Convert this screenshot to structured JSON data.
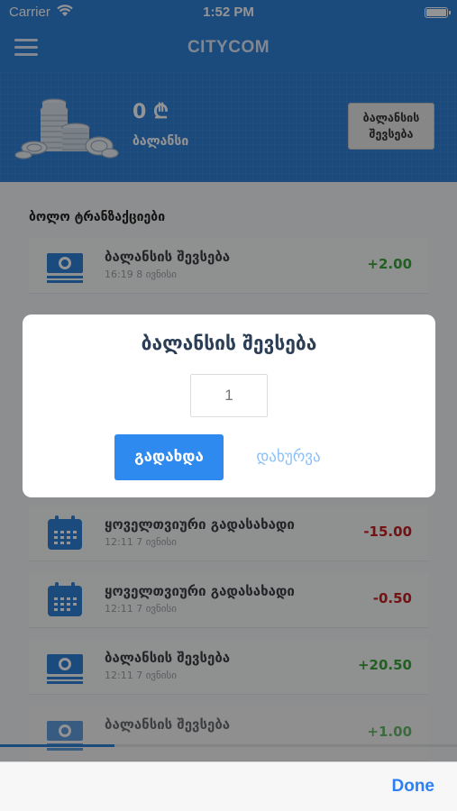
{
  "status_bar": {
    "carrier": "Carrier",
    "time": "1:52 PM"
  },
  "nav": {
    "title": "CITYCOM",
    "menu_icon": "hamburger-menu-icon"
  },
  "balance": {
    "value": "0 ₾",
    "label": "ბალანსი",
    "topup_button": "ბალანსის შევსება",
    "icon": "coins-stack-icon"
  },
  "transactions": {
    "title": "ბოლო ტრანზაქციები",
    "items": [
      {
        "name": "ბალანსის შევსება",
        "date": "16:19 8 ივნისი",
        "amount": "+2.00",
        "type": "topup",
        "icon": "money-icon"
      },
      {
        "name": "ყოველთვიური გადასახადი",
        "date": "12:11 7 ივნისი",
        "amount": "-15.00",
        "type": "fee",
        "icon": "calendar-icon"
      },
      {
        "name": "ყოველთვიური გადასახადი",
        "date": "12:11 7 ივნისი",
        "amount": "-0.50",
        "type": "fee",
        "icon": "calendar-icon"
      },
      {
        "name": "ბალანსის შევსება",
        "date": "12:11 7 ივნისი",
        "amount": "+20.50",
        "type": "topup",
        "icon": "money-icon"
      },
      {
        "name": "ბალანსის შევსება",
        "date": "",
        "amount": "+1.00",
        "type": "topup",
        "icon": "money-icon"
      }
    ]
  },
  "dialog": {
    "title": "ბალანსის შევსება",
    "amount_placeholder": "1",
    "pay_button": "გადახდა",
    "close_button": "დახურვა"
  },
  "keyboard_toolbar": {
    "done_button": "Done"
  },
  "colors": {
    "primary": "#2f80d8",
    "button": "#2f8af0",
    "positive": "#3aa53a",
    "negative": "#c42020"
  },
  "scroll_progress": 0.25
}
